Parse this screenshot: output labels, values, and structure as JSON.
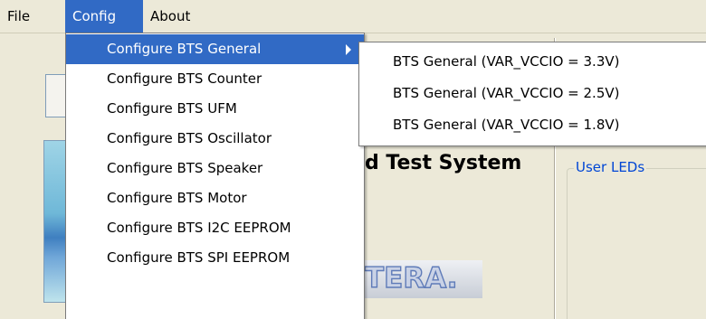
{
  "menubar": {
    "items": [
      {
        "label": "File"
      },
      {
        "label": "Config"
      },
      {
        "label": "About"
      }
    ]
  },
  "config_menu": {
    "items": [
      {
        "label": "Configure BTS General",
        "has_submenu": true,
        "highlighted": true
      },
      {
        "label": "Configure BTS Counter"
      },
      {
        "label": "Configure BTS UFM"
      },
      {
        "label": "Configure BTS Oscillator"
      },
      {
        "label": "Configure BTS Speaker"
      },
      {
        "label": "Configure BTS Motor"
      },
      {
        "label": "Configure BTS I2C EEPROM"
      },
      {
        "label": "Configure BTS SPI EEPROM"
      }
    ]
  },
  "general_submenu": {
    "items": [
      {
        "label": "BTS General (VAR_VCCIO = 3.3V)"
      },
      {
        "label": "BTS General (VAR_VCCIO = 2.5V)"
      },
      {
        "label": "BTS General (VAR_VCCIO = 1.8V)"
      }
    ]
  },
  "background": {
    "title_fragment": "d Test System",
    "group_label": "User LEDs",
    "logo_fragment": "TERA."
  },
  "colors": {
    "highlight": "#316ac5",
    "window_bg": "#ece9d8",
    "group_label": "#0046d5"
  }
}
